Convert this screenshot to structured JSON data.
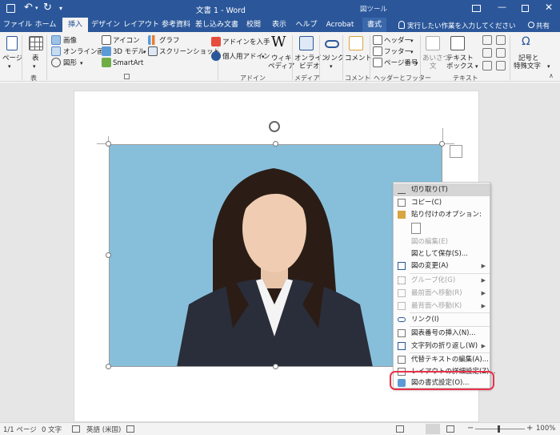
{
  "titlebar": {
    "title": "文書 1 - Word",
    "context_tab_group": "図ツール"
  },
  "tabs": [
    {
      "label": "ファイル"
    },
    {
      "label": "ホーム"
    },
    {
      "label": "挿入"
    },
    {
      "label": "デザイン"
    },
    {
      "label": "レイアウト"
    },
    {
      "label": "参考資料"
    },
    {
      "label": "差し込み文書"
    },
    {
      "label": "校閲"
    },
    {
      "label": "表示"
    },
    {
      "label": "ヘルプ"
    },
    {
      "label": "Acrobat"
    },
    {
      "label": "書式"
    }
  ],
  "tell_me": "実行したい作業を入力してください",
  "share": "共有",
  "ribbon": {
    "page": "ページ",
    "table": "表",
    "table_group": "表",
    "image": "画像",
    "online_image": "オンライン画像",
    "shapes": "図形",
    "icons": "アイコン",
    "model3d": "3D モデル",
    "smartart": "SmartArt",
    "chart": "グラフ",
    "screenshot": "スクリーンショット",
    "get_addins": "アドインを入手",
    "my_addins": "個人用アドイン",
    "wikipedia_1": "ウィキ",
    "wikipedia_2": "ペディア",
    "addins_group": "アドイン",
    "online_video_1": "オンライン",
    "online_video_2": "ビデオ",
    "media_group": "メディア",
    "link": "リンク",
    "comment": "コメント",
    "comment_group": "コメント",
    "header": "ヘッダー",
    "footer": "フッター",
    "page_number": "ページ番号",
    "hf_group": "ヘッダーとフッター",
    "furigana_1": "あいさつ",
    "furigana_2": "文",
    "textbox_1": "テキスト",
    "textbox_2": "ボックス",
    "text_group": "テキスト",
    "symbol_1": "記号と",
    "symbol_2": "特殊文字"
  },
  "context_menu": {
    "items": [
      {
        "label": "切り取り(T)",
        "state": "highlight"
      },
      {
        "label": "コピー(C)",
        "state": "normal"
      },
      {
        "label": "貼り付けのオプション:",
        "state": "normal"
      },
      {
        "label": "図の編集(E)",
        "state": "disabled"
      },
      {
        "label": "図として保存(S)...",
        "state": "normal"
      },
      {
        "label": "図の変更(A)",
        "state": "normal"
      },
      {
        "label": "グループ化(G)",
        "state": "disabled"
      },
      {
        "label": "最前面へ移動(R)",
        "state": "disabled"
      },
      {
        "label": "最背面へ移動(K)",
        "state": "disabled"
      },
      {
        "label": "リンク(I)",
        "state": "normal"
      },
      {
        "label": "図表番号の挿入(N)...",
        "state": "normal"
      },
      {
        "label": "文字列の折り返し(W)",
        "state": "normal"
      },
      {
        "label": "代替テキストの編集(A)...",
        "state": "normal"
      },
      {
        "label": "レイアウトの詳細設定(Z)...",
        "state": "normal"
      },
      {
        "label": "図の書式設定(O)...",
        "state": "normal"
      }
    ]
  },
  "statusbar": {
    "page": "1/1 ページ",
    "words": "0 文字",
    "language": "英語 (米国)",
    "zoom": "100%"
  },
  "colors": {
    "word_blue": "#2b579a",
    "picture_bg": "#87bfdb",
    "annotation_red": "#e8334a"
  }
}
